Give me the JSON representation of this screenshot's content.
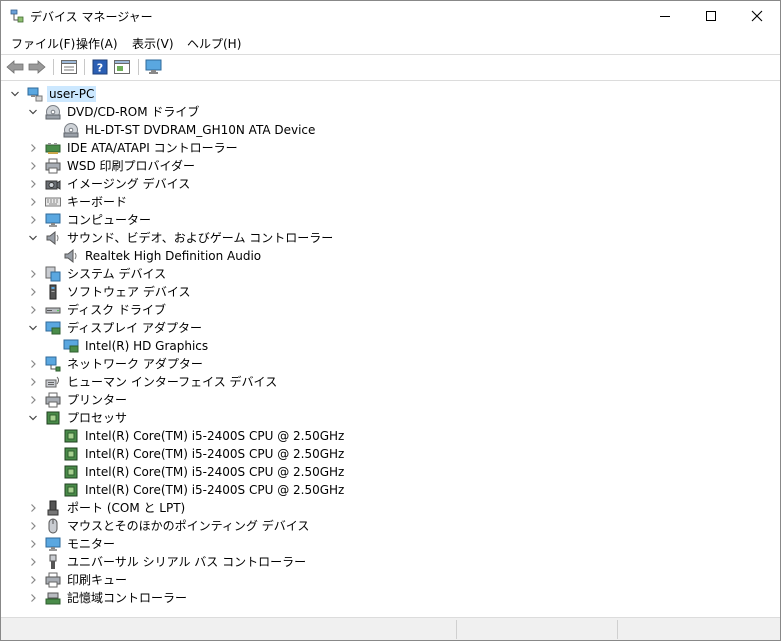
{
  "window": {
    "title": "デバイス マネージャー"
  },
  "menu": [
    "ファイル(F)",
    "操作(A)",
    "表示(V)",
    "ヘルプ(H)"
  ],
  "tree": {
    "root": "user-PC",
    "categories": [
      {
        "label": "DVD/CD-ROM ドライブ",
        "icon": "dvd-drive-icon",
        "expanded": true,
        "children": [
          {
            "label": "HL-DT-ST DVDRAM_GH10N ATA Device",
            "icon": "dvd-drive-icon"
          }
        ]
      },
      {
        "label": "IDE ATA/ATAPI コントローラー",
        "icon": "ide-controller-icon",
        "expanded": false
      },
      {
        "label": "WSD 印刷プロバイダー",
        "icon": "printer-icon",
        "expanded": false
      },
      {
        "label": "イメージング デバイス",
        "icon": "camera-icon",
        "expanded": false
      },
      {
        "label": "キーボード",
        "icon": "keyboard-icon",
        "expanded": false
      },
      {
        "label": "コンピューター",
        "icon": "computer-icon",
        "expanded": false
      },
      {
        "label": "サウンド、ビデオ、およびゲーム コントローラー",
        "icon": "speaker-icon",
        "expanded": true,
        "children": [
          {
            "label": "Realtek High Definition Audio",
            "icon": "speaker-icon"
          }
        ]
      },
      {
        "label": "システム デバイス",
        "icon": "system-device-icon",
        "expanded": false
      },
      {
        "label": "ソフトウェア デバイス",
        "icon": "software-device-icon",
        "expanded": false
      },
      {
        "label": "ディスク ドライブ",
        "icon": "disk-drive-icon",
        "expanded": false
      },
      {
        "label": "ディスプレイ アダプター",
        "icon": "display-adapter-icon",
        "expanded": true,
        "children": [
          {
            "label": "Intel(R) HD Graphics",
            "icon": "display-adapter-icon"
          }
        ]
      },
      {
        "label": "ネットワーク アダプター",
        "icon": "network-adapter-icon",
        "expanded": false
      },
      {
        "label": "ヒューマン インターフェイス デバイス",
        "icon": "hid-icon",
        "expanded": false
      },
      {
        "label": "プリンター",
        "icon": "printer-icon",
        "expanded": false
      },
      {
        "label": "プロセッサ",
        "icon": "processor-icon",
        "expanded": true,
        "children": [
          {
            "label": "Intel(R) Core(TM) i5-2400S CPU @ 2.50GHz",
            "icon": "processor-icon"
          },
          {
            "label": "Intel(R) Core(TM) i5-2400S CPU @ 2.50GHz",
            "icon": "processor-icon"
          },
          {
            "label": "Intel(R) Core(TM) i5-2400S CPU @ 2.50GHz",
            "icon": "processor-icon"
          },
          {
            "label": "Intel(R) Core(TM) i5-2400S CPU @ 2.50GHz",
            "icon": "processor-icon"
          }
        ]
      },
      {
        "label": "ポート (COM と LPT)",
        "icon": "port-icon",
        "expanded": false
      },
      {
        "label": "マウスとそのほかのポインティング デバイス",
        "icon": "mouse-icon",
        "expanded": false
      },
      {
        "label": "モニター",
        "icon": "monitor-icon",
        "expanded": false
      },
      {
        "label": "ユニバーサル シリアル バス コントローラー",
        "icon": "usb-icon",
        "expanded": false
      },
      {
        "label": "印刷キュー",
        "icon": "print-queue-icon",
        "expanded": false
      },
      {
        "label": "記憶域コントローラー",
        "icon": "storage-controller-icon",
        "expanded": false
      }
    ]
  }
}
